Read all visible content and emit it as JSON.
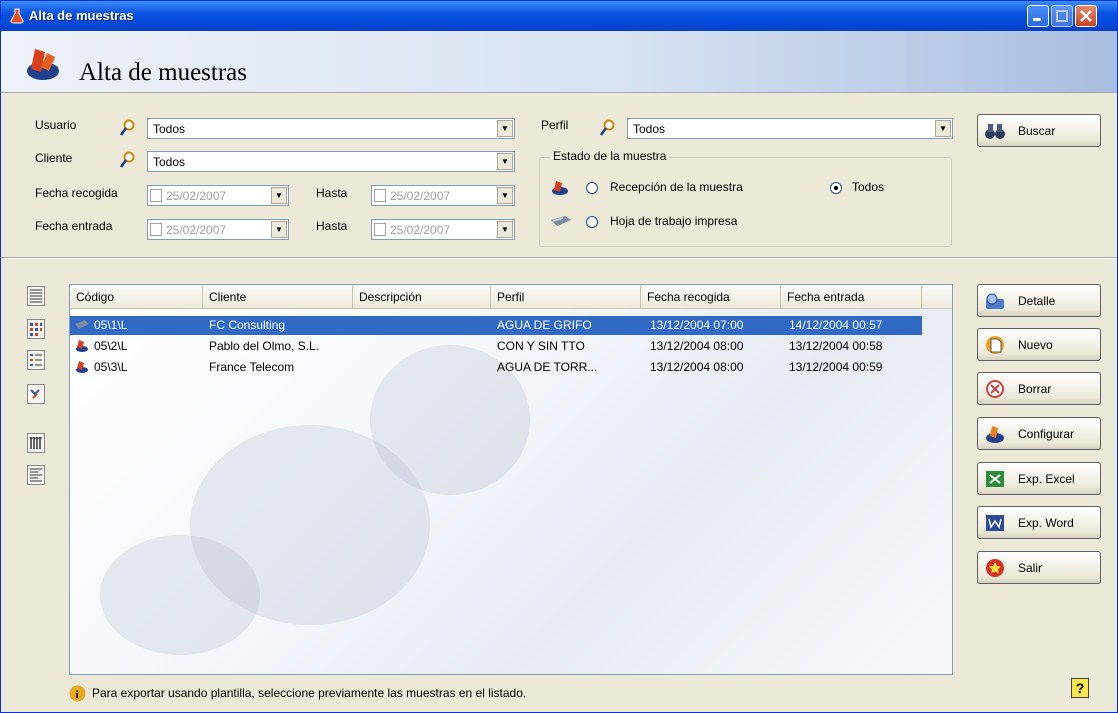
{
  "window": {
    "title": "Alta de muestras"
  },
  "header": {
    "title": "Alta de muestras"
  },
  "filters": {
    "usuario_label": "Usuario",
    "usuario_value": "Todos",
    "cliente_label": "Cliente",
    "cliente_value": "Todos",
    "perfil_label": "Perfil",
    "perfil_value": "Todos",
    "fecha_recogida_label": "Fecha recogida",
    "fecha_recogida_value": "25/02/2007",
    "hasta1_label": "Hasta",
    "hasta1_value": "25/02/2007",
    "fecha_entrada_label": "Fecha entrada",
    "fecha_entrada_value": "25/02/2007",
    "hasta2_label": "Hasta",
    "hasta2_value": "25/02/2007"
  },
  "estado": {
    "group_label": "Estado de la muestra",
    "opt_recepcion": "Recepción de la muestra",
    "opt_hoja": "Hoja de trabajo impresa",
    "opt_todos": "Todos",
    "selected": "Todos"
  },
  "buttons": {
    "buscar": "Buscar",
    "detalle": "Detalle",
    "nuevo": "Nuevo",
    "borrar": "Borrar",
    "configurar": "Configurar",
    "exp_excel": "Exp. Excel",
    "exp_word": "Exp. Word",
    "salir": "Salir"
  },
  "table": {
    "columns": [
      "Código",
      "Cliente",
      "Descripción",
      "Perfil",
      "Fecha recogida",
      "Fecha entrada"
    ],
    "rows": [
      {
        "codigo": "05\\1\\L",
        "cliente": "FC Consulting",
        "descripcion": "",
        "perfil": "AGUA DE GRIFO",
        "fecha_recogida": "13/12/2004 07:00",
        "fecha_entrada": "14/12/2004 00:57",
        "icon": "truck-icon"
      },
      {
        "codigo": "05\\2\\L",
        "cliente": "Pablo del Olmo, S.L.",
        "descripcion": "",
        "perfil": "CON Y SIN TTO",
        "fecha_recogida": "13/12/2004 08:00",
        "fecha_entrada": "13/12/2004 00:58",
        "icon": "flask-icon"
      },
      {
        "codigo": "05\\3\\L",
        "cliente": "France Telecom",
        "descripcion": "",
        "perfil": "AGUA DE TORR...",
        "fecha_recogida": "13/12/2004 08:00",
        "fecha_entrada": "13/12/2004 00:59",
        "icon": "flask-icon"
      }
    ],
    "selected_row": 0
  },
  "footer": {
    "info": "Para exportar usando plantilla, seleccione previamente las muestras en el listado.",
    "help": "?"
  },
  "colors": {
    "title_bar": "#0a54e3",
    "selection": "#316ac5",
    "window_bg": "#ece9d8"
  }
}
